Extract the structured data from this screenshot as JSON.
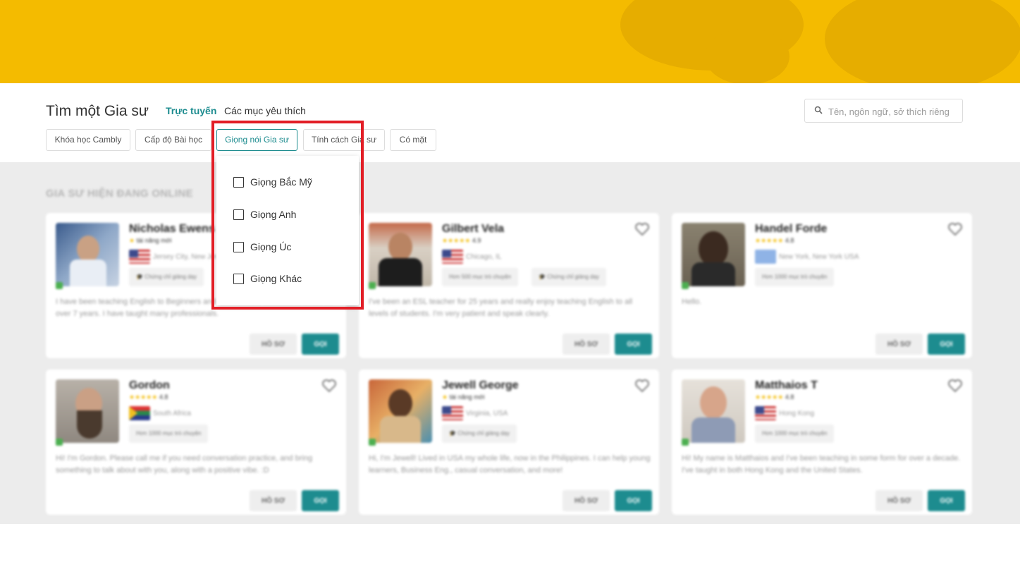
{
  "header": {
    "title": "Tìm một Gia sư",
    "nav_online": "Trực tuyến",
    "nav_favorites": "Các mục yêu thích",
    "search_placeholder": "Tên, ngôn ngữ, sở thích riêng"
  },
  "filters": [
    {
      "label": "Khóa học Cambly"
    },
    {
      "label": "Cấp độ Bài học"
    },
    {
      "label": "Giọng nói Gia sư"
    },
    {
      "label": "Tính cách Gia sư"
    },
    {
      "label": "Có mặt"
    }
  ],
  "accent_dropdown": {
    "options": [
      "Giọng Bắc Mỹ",
      "Giọng Anh",
      "Giọng Úc",
      "Giọng Khác"
    ]
  },
  "section_title": "GIA SƯ HIỆN ĐANG ONLINE",
  "buttons": {
    "profile": "HỒ SƠ",
    "call": "GỌI"
  },
  "tutors": [
    {
      "name": "Nicholas Ewens",
      "rating_text": "tài năng mới",
      "location": "Jersey City, New Jersey",
      "chips": [
        "Chứng chỉ giảng dạy"
      ],
      "description": "I have been teaching English to Beginners and Intermediate students in Brazil for over 7 years. I have taught many professionals."
    },
    {
      "name": "Gilbert Vela",
      "rating_text": "4.9",
      "location": "Chicago, IL",
      "chips": [
        "Hơn 500 mục trò chuyện",
        "Chứng chỉ giảng dạy"
      ],
      "description": "I've been an ESL teacher for 25 years and really enjoy teaching English to all levels of students. I'm very patient and speak clearly."
    },
    {
      "name": "Handel Forde",
      "rating_text": "4.8",
      "location": "New York, New York USA",
      "chips": [
        "Hơn 1000 mục trò chuyện"
      ],
      "description": "Hello."
    },
    {
      "name": "Gordon",
      "rating_text": "4.8",
      "location": "South Africa",
      "chips": [
        "Hơn 1000 mục trò chuyện"
      ],
      "description": "Hi! I'm Gordon. Please call me if you need conversation practice, and bring something to talk about with you, along with a positive vibe. :D"
    },
    {
      "name": "Jewell George",
      "rating_text": "tài năng mới",
      "location": "Virginia, USA",
      "chips": [
        "Chứng chỉ giảng dạy"
      ],
      "description": "Hi, I'm Jewell! Lived in USA my whole life, now in the Philippines. I can help young learners, Business Eng., casual conversation, and more!"
    },
    {
      "name": "Matthaios T",
      "rating_text": "4.8",
      "location": "Hong Kong",
      "chips": [
        "Hơn 1000 mục trò chuyện"
      ],
      "description": "Hi! My name is Matthaios and I've been teaching in some form for over a decade. I've taught in both Hong Kong and the United States."
    }
  ],
  "colors": {
    "banner": "#f4bb00",
    "accent": "#1d8c8f",
    "highlight": "#e21e26",
    "star": "#f4bb00"
  }
}
